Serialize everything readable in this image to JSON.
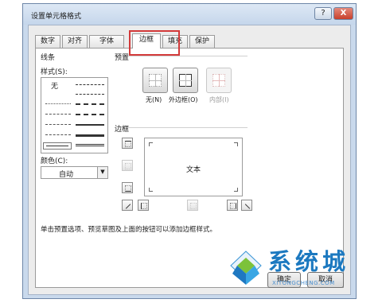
{
  "window": {
    "title": "设置单元格格式",
    "help_label": "?",
    "close_label": "X"
  },
  "tabs": [
    {
      "label": "数字"
    },
    {
      "label": "对齐"
    },
    {
      "label": "字体"
    },
    {
      "label": "边框",
      "active": true
    },
    {
      "label": "填充"
    },
    {
      "label": "保护"
    }
  ],
  "line": {
    "group_label": "线条",
    "style_label": "样式(S):",
    "none_label": "无",
    "color_label": "颜色(C):",
    "color_value": "自动"
  },
  "presets": {
    "group_label": "预置",
    "items": [
      {
        "label": "无(N)"
      },
      {
        "label": "外边框(O)"
      },
      {
        "label": "内部(I)"
      }
    ]
  },
  "border": {
    "group_label": "边框",
    "preview_text": "文本"
  },
  "hint": "单击预置选项、预览草图及上面的按钮可以添加边框样式。",
  "buttons": {
    "ok": "确定",
    "cancel": "取消"
  },
  "watermark": {
    "text": "系统城",
    "sub": "XITONGCHENG.COM"
  },
  "colors": {
    "accent_highlight": "#d33a3a",
    "watermark_blue": "#1c79c0"
  }
}
